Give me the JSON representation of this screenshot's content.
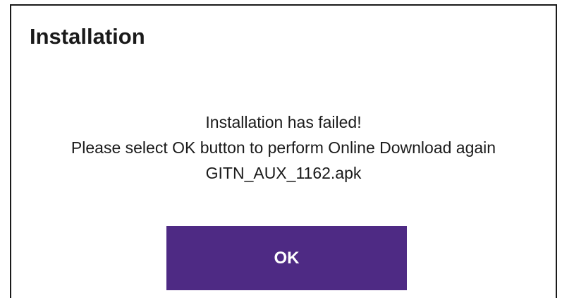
{
  "dialog": {
    "title": "Installation",
    "message_lines": [
      "Installation has failed!",
      "Please select OK button to perform Online Download again",
      "GITN_AUX_1162.apk"
    ],
    "ok_label": "OK"
  },
  "colors": {
    "button_background": "#4e2a84",
    "button_text": "#ffffff",
    "text": "#1a1a1a",
    "background": "#ffffff"
  }
}
